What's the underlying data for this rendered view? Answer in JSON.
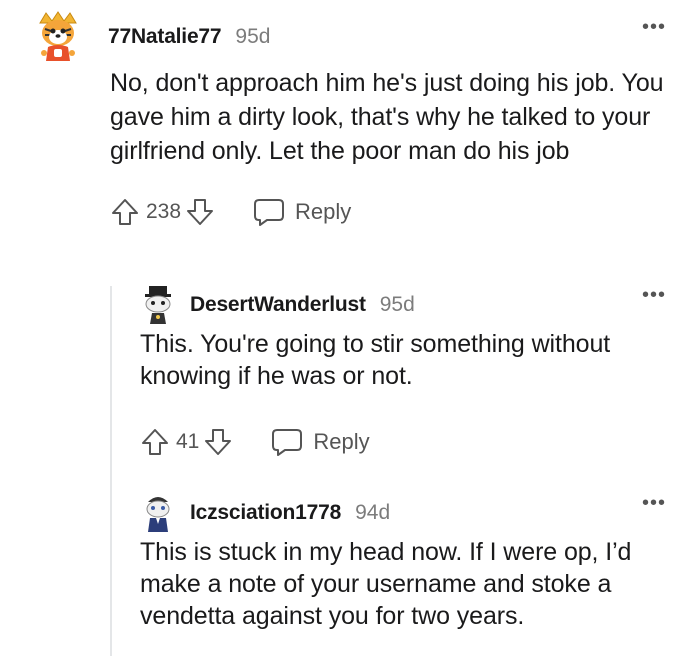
{
  "comments": [
    {
      "username": "77Natalie77",
      "age": "95d",
      "more": "•••",
      "text": "No, don't approach him he's just doing his job. You gave him a dirty look, that's why he talked to your girlfriend only. Let the poor man do his job",
      "score": "238",
      "reply_label": "Reply",
      "avatar_icon": "snoo-avatar-tiger-icon"
    },
    {
      "username": "DesertWanderlust",
      "age": "95d",
      "more": "•••",
      "text": "This. You're going to stir something without knowing if he was or not.",
      "score": "41",
      "reply_label": "Reply",
      "avatar_icon": "snoo-avatar-top-hat-icon"
    },
    {
      "username": "Iczsciation1778",
      "age": "94d",
      "more": "•••",
      "text": "This is stuck in my head now. If I were op, I’d make a note of your username and stoke a vendetta against you for two years.",
      "avatar_icon": "snoo-avatar-suit-icon"
    }
  ],
  "colors": {
    "text": "#1a1a1b",
    "muted": "#7c7c7c",
    "thread_line": "#e4e6e8"
  }
}
